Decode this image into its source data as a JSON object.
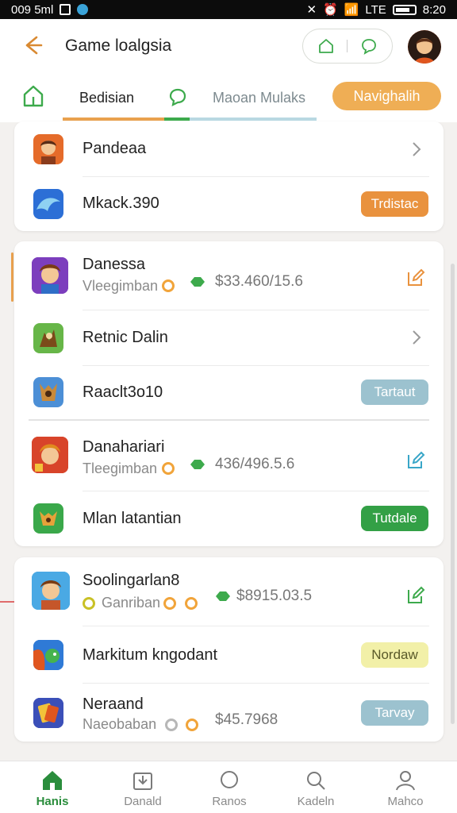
{
  "status_bar": {
    "left": "009 5ml",
    "time": "8:20",
    "signal": "LTE"
  },
  "header": {
    "title": "Game loalgsia",
    "back_icon": "arrow-left-icon",
    "pill_icons": [
      "house-outline-icon",
      "chat-bubble-icon"
    ],
    "avatar_icon": "user-avatar-icon"
  },
  "tabs": {
    "items": [
      "Bedisian",
      "Maoan Mulaks"
    ],
    "active_button": "Navighalih",
    "accent": "#efae55"
  },
  "card1": {
    "rows": [
      {
        "name": "Pandeaa",
        "icon": "character-app-icon",
        "action": "chevron-right-icon"
      },
      {
        "name": "Mkack.390",
        "icon": "wave-app-icon",
        "badge": "Trdistac",
        "badge_color": "#e9923e"
      }
    ]
  },
  "card2": {
    "rows": [
      {
        "name": "Danessa",
        "sub": "Vleegimban",
        "price": "$33.460/15.6",
        "icon": "hero-app-icon",
        "action": "edit-icon"
      },
      {
        "name": "Retnic Dalin",
        "icon": "dragon-app-icon",
        "action": "chevron-right-icon"
      },
      {
        "name": "Raaclt3o10",
        "icon": "creature-app-icon",
        "badge": "Tartaut",
        "badge_color": "#9cc2cf"
      },
      {
        "name": "Danahariari",
        "sub": "Tleegimban",
        "price": "436/496.5.6",
        "icon": "warrior-app-icon",
        "action": "edit-icon"
      },
      {
        "name": "Mlan latantian",
        "icon": "fox-app-icon",
        "badge": "Tutdale",
        "badge_color": "#33a046"
      }
    ]
  },
  "card3": {
    "rows": [
      {
        "name": "Soolingarlan8",
        "sub": "Ganriban",
        "price": "$8915.03.5",
        "icon": "knight-app-icon",
        "action": "edit-icon"
      },
      {
        "name": "Markitum kngodant",
        "icon": "bird-app-icon",
        "badge": "Nordaw",
        "badge_color": "#f2f0a8"
      },
      {
        "name": "Neraand",
        "sub": "Naeobaban",
        "price": "$45.7968",
        "icon": "cards-app-icon",
        "badge": "Tarvay",
        "badge_color": "#9cc2cf"
      }
    ]
  },
  "bottom_nav": {
    "items": [
      {
        "label": "Hanis",
        "icon": "home-icon",
        "active": true
      },
      {
        "label": "Danald",
        "icon": "inbox-icon"
      },
      {
        "label": "Ranos",
        "icon": "chat-icon"
      },
      {
        "label": "Kadeln",
        "icon": "search-icon"
      },
      {
        "label": "Mahco",
        "icon": "profile-icon"
      }
    ]
  }
}
